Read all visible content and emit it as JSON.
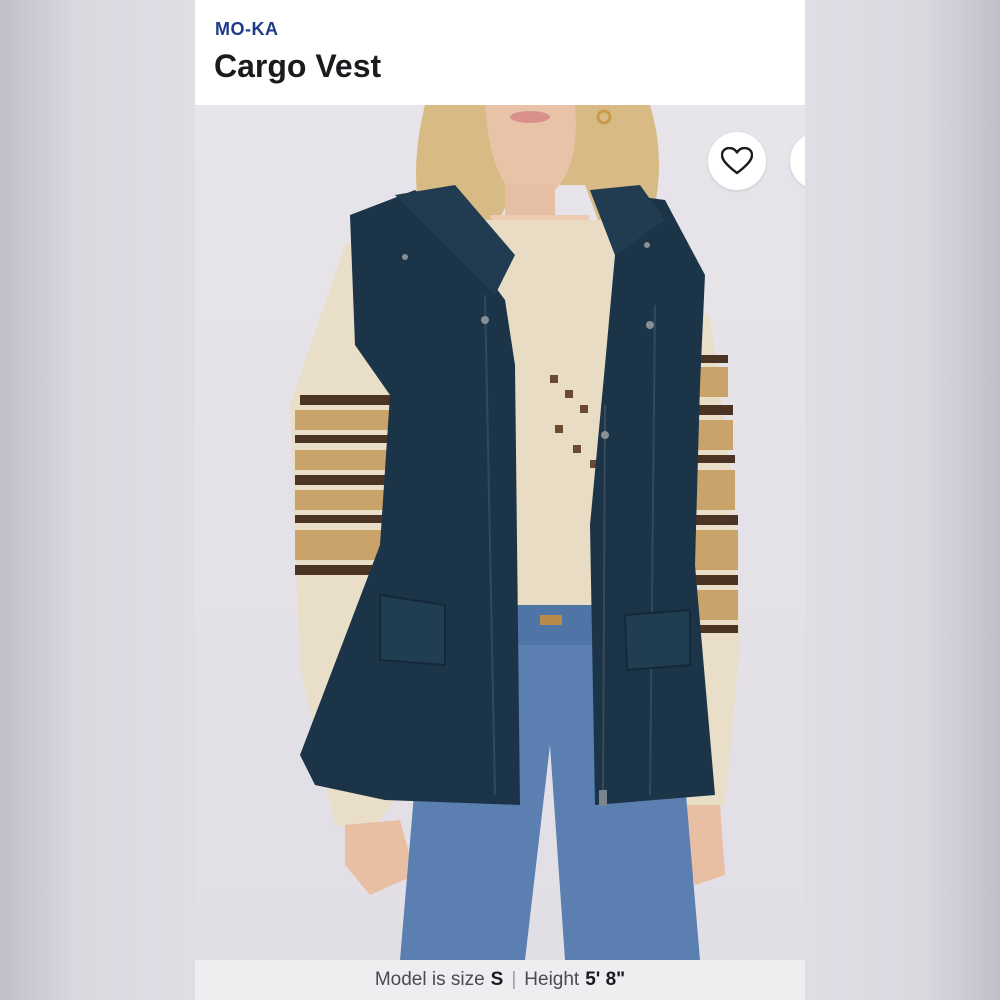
{
  "product": {
    "brand": "MO-KA",
    "title": "Cargo Vest"
  },
  "actions": {
    "favorite_icon": "heart-outline-icon",
    "share_icon": "share-icon"
  },
  "model_info": {
    "size_label": "Model is size",
    "size_value": "S",
    "separator": "|",
    "height_label": "Height",
    "height_value": "5' 8\""
  },
  "colors": {
    "brand": "#1e3a8a",
    "vest": "#1c3447",
    "sweater": "#e8dcc4",
    "jeans": "#5a7fb0"
  }
}
